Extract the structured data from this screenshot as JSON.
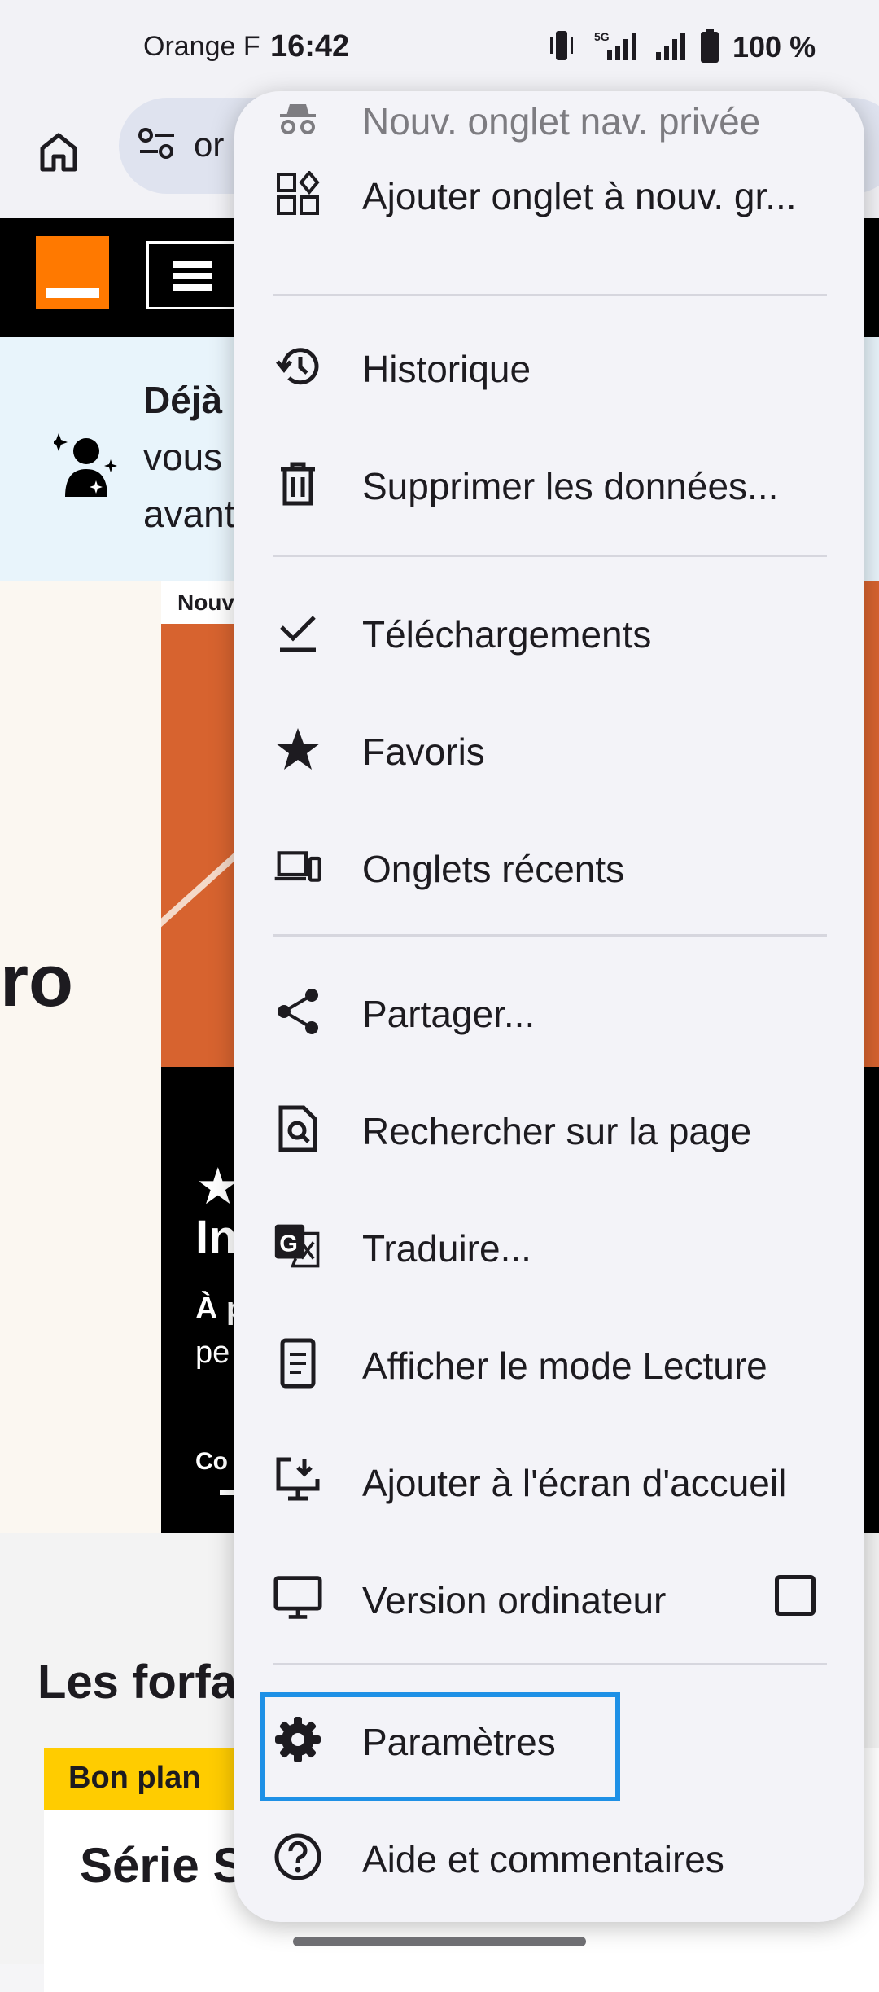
{
  "status_bar": {
    "carrier": "Orange F",
    "time": "16:42",
    "battery": "100 %"
  },
  "toolbar": {
    "url_partial": "or"
  },
  "site": {
    "banner": {
      "line1": "Déjà",
      "line2": "vous",
      "line3": "avant"
    },
    "hero_left_text": "ro",
    "hero_tag": "Nouv",
    "hero_dark": {
      "star": "★",
      "heading": "In",
      "p1": "À p",
      "p2": "pe",
      "c1": "Co"
    },
    "section_title": "Les forfa",
    "card": {
      "badge": "Bon plan",
      "title": "Série S"
    }
  },
  "menu": {
    "items": [
      {
        "label": "Nouv. onglet nav. privée",
        "icon": "incognito-icon"
      },
      {
        "label": "Ajouter onglet à nouv. gr...",
        "icon": "tab-group-add-icon"
      },
      {
        "label": "Historique",
        "icon": "history-icon"
      },
      {
        "label": "Supprimer les données...",
        "icon": "trash-icon"
      },
      {
        "label": "Téléchargements",
        "icon": "download-check-icon"
      },
      {
        "label": "Favoris",
        "icon": "star-icon"
      },
      {
        "label": "Onglets récents",
        "icon": "devices-icon"
      },
      {
        "label": "Partager...",
        "icon": "share-icon"
      },
      {
        "label": "Rechercher sur la page",
        "icon": "find-in-page-icon"
      },
      {
        "label": "Traduire...",
        "icon": "translate-icon"
      },
      {
        "label": "Afficher le mode Lecture",
        "icon": "reader-mode-icon"
      },
      {
        "label": "Ajouter à l'écran d'accueil",
        "icon": "add-to-home-icon"
      },
      {
        "label": "Version ordinateur",
        "icon": "desktop-icon",
        "checked": false
      },
      {
        "label": "Paramètres",
        "icon": "gear-icon",
        "highlighted": true
      },
      {
        "label": "Aide et commentaires",
        "icon": "help-icon"
      }
    ]
  },
  "colors": {
    "menu_bg": "#f3f3f8",
    "highlight": "#1e90e6",
    "orange": "#ff7900",
    "badge": "#ffcc00"
  }
}
